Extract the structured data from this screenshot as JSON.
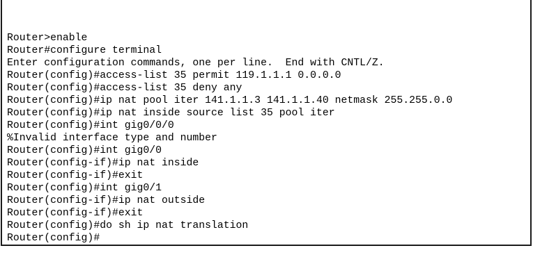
{
  "terminal": {
    "lines": [
      "Router>enable",
      "Router#configure terminal",
      "Enter configuration commands, one per line.  End with CNTL/Z.",
      "Router(config)#access-list 35 permit 119.1.1.1 0.0.0.0",
      "Router(config)#access-list 35 deny any",
      "Router(config)#ip nat pool iter 141.1.1.3 141.1.1.40 netmask 255.255.0.0",
      "Router(config)#ip nat inside source list 35 pool iter",
      "Router(config)#int gig0/0/0",
      "%Invalid interface type and number",
      "Router(config)#int gig0/0",
      "Router(config-if)#ip nat inside",
      "Router(config-if)#exit",
      "Router(config)#int gig0/1",
      "Router(config-if)#ip nat outside",
      "Router(config-if)#exit",
      "Router(config)#do sh ip nat translation",
      "Router(config)#"
    ]
  }
}
